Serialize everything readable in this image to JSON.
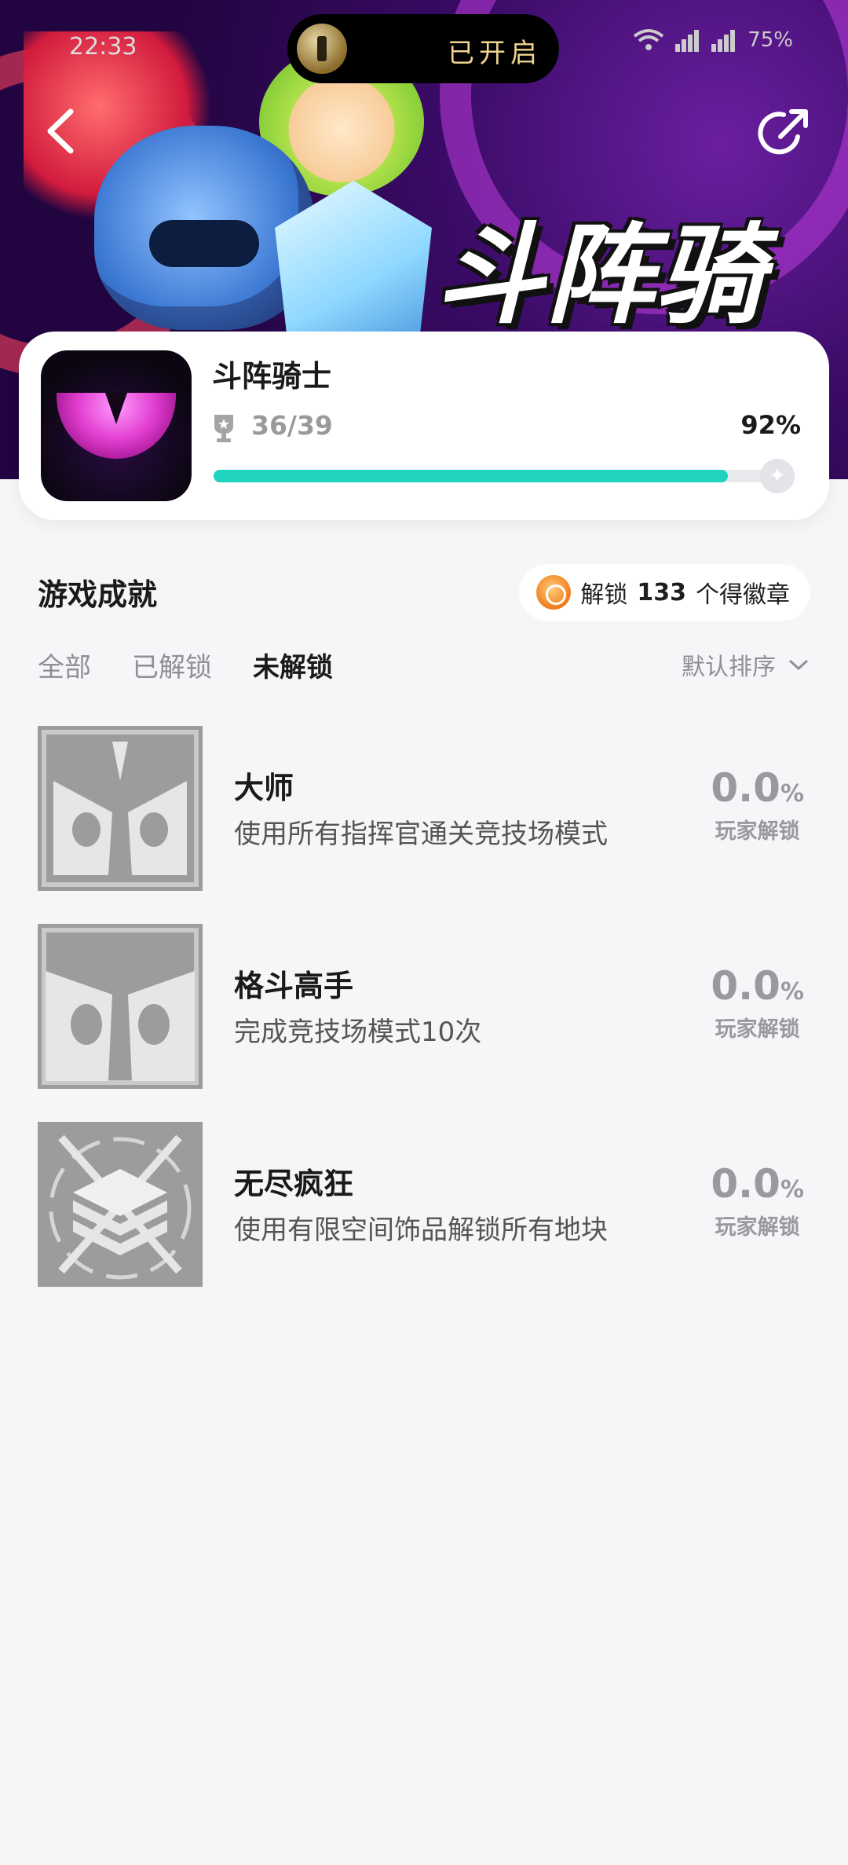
{
  "status_bar": {
    "time": "22:33",
    "island_text": "已开启",
    "battery": "75%"
  },
  "banner": {
    "title": "斗阵骑士"
  },
  "game": {
    "name": "斗阵骑士",
    "achievement_count": "36/39",
    "progress_percent": "92%",
    "progress_fraction": 0.92
  },
  "achievements": {
    "title": "游戏成就",
    "badge": {
      "prefix": "解锁",
      "count": "133",
      "suffix": "个得徽章"
    },
    "tabs": [
      {
        "label": "全部",
        "active": false
      },
      {
        "label": "已解锁",
        "active": false
      },
      {
        "label": "未解锁",
        "active": true
      }
    ],
    "sort_label": "默认排序",
    "items": [
      {
        "title": "大师",
        "desc": "使用所有指挥官通关竞技场模式",
        "rate": "0.0",
        "unit": "%",
        "rate_label": "玩家解锁"
      },
      {
        "title": "格斗高手",
        "desc": "完成竞技场模式10次",
        "rate": "0.0",
        "unit": "%",
        "rate_label": "玩家解锁"
      },
      {
        "title": "无尽疯狂",
        "desc": "使用有限空间饰品解锁所有地块",
        "rate": "0.0",
        "unit": "%",
        "rate_label": "玩家解锁"
      }
    ]
  },
  "colors": {
    "accent": "#1fd3bf",
    "background": "#f5f6f8"
  },
  "icons": [
    "back-icon",
    "share-icon",
    "trophy-icon",
    "medal-icon",
    "chevron-down-icon",
    "flashlight-icon",
    "wifi-icon",
    "signal-icon"
  ]
}
